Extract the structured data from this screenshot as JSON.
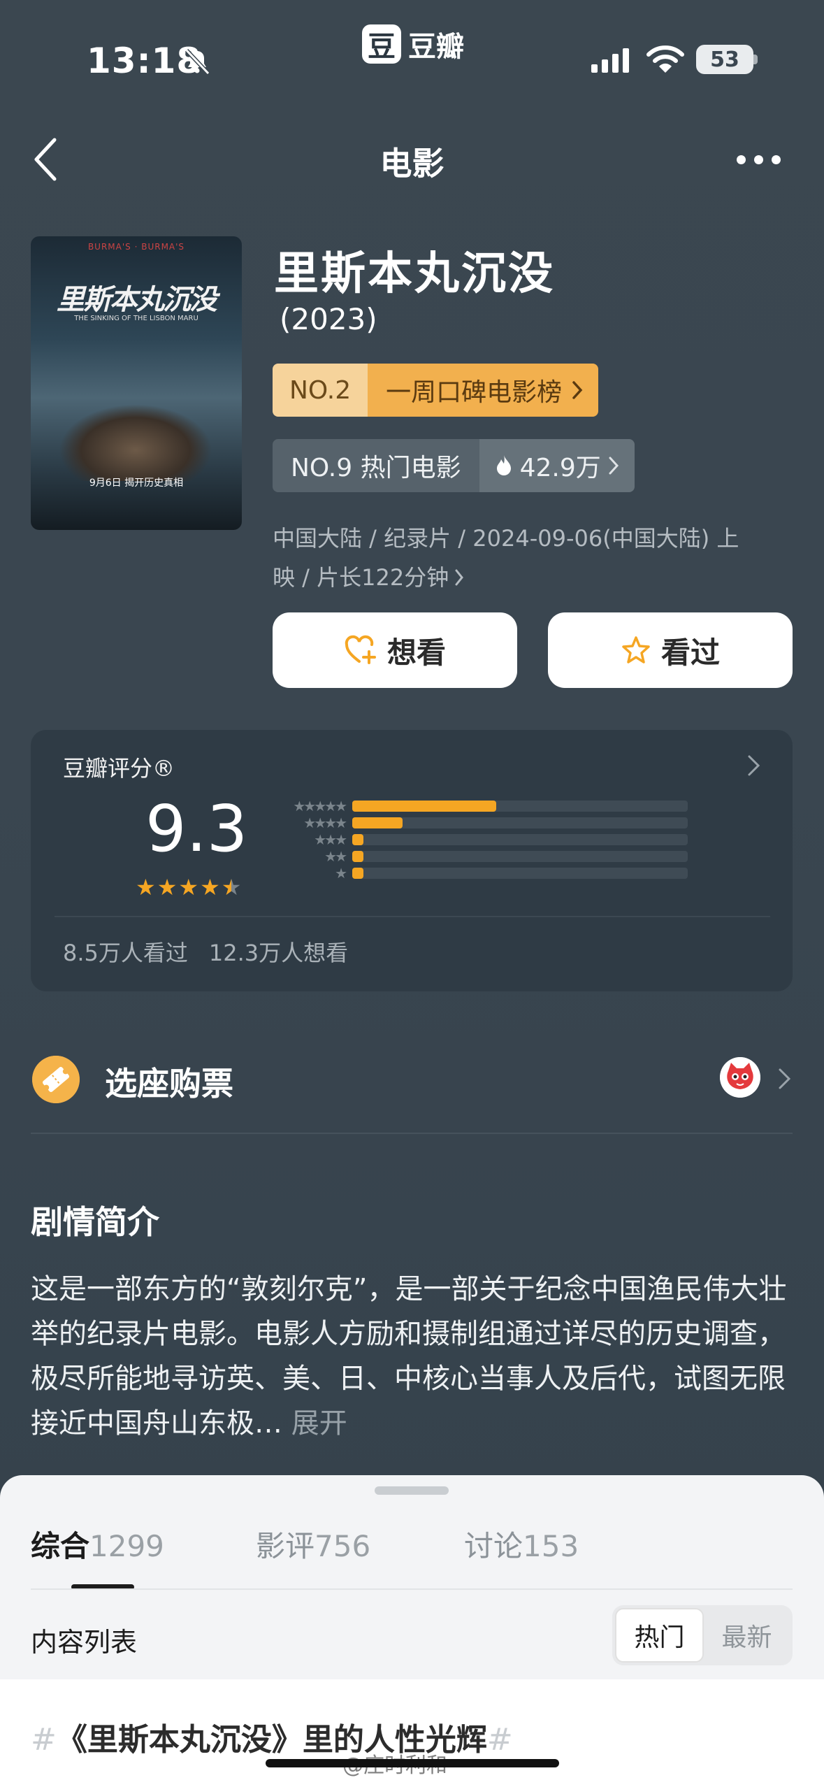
{
  "status_bar": {
    "time": "13:18",
    "brand_char": "豆",
    "brand_name": "豆瓣",
    "battery": "53"
  },
  "nav": {
    "title": "电影"
  },
  "movie": {
    "poster": {
      "top_text": "BURMA'S · BURMA'S",
      "title": "里斯本丸沉没",
      "subtitle": "THE SINKING OF THE LISBON MARU",
      "date": "9月6日 揭开历史真相"
    },
    "title": "里斯本丸沉没",
    "year": "(2023)",
    "rank_no": "NO.2",
    "rank_label": "一周口碑电影榜",
    "hot_label": "NO.9 热门电影",
    "hot_count": "42.9万",
    "meta_line1": "中国大陆 / 纪录片 / 2024-09-06(中国大陆) 上",
    "meta_line2": "映 / 片长122分钟"
  },
  "actions": {
    "want": "想看",
    "seen": "看过"
  },
  "rating": {
    "label": "豆瓣评分®",
    "score": "9.3",
    "stars": 4.5,
    "distribution": [
      0.43,
      0.15,
      0.02,
      0.02,
      0.02
    ],
    "watched": "8.5万人看过",
    "want": "12.3万人想看"
  },
  "ticket": {
    "label": "选座购票"
  },
  "synopsis": {
    "title": "剧情简介",
    "text": "这是一部东方的“敦刻尔克”，是一部关于纪念中国渔民伟大壮举的纪录片电影。电影人方励和摄制组通过详尽的历史调查，极尽所能地寻访英、美、日、中核心当事人及后代，试图无限接近中国舟山东极…",
    "expand": "展开"
  },
  "sheet": {
    "tabs": [
      {
        "label": "综合",
        "count": "1299"
      },
      {
        "label": "影评",
        "count": "756"
      },
      {
        "label": "讨论",
        "count": "153"
      }
    ],
    "list_label": "内容列表",
    "sort_hot": "热门",
    "sort_new": "最新",
    "hashtag": "《里斯本丸沉没》里的人性光辉",
    "hash_mark": "#"
  },
  "watermark": "@庄时利和",
  "colors": {
    "accent": "#f5a623",
    "background": "#3a4650",
    "sheet": "#f3f4f6"
  }
}
